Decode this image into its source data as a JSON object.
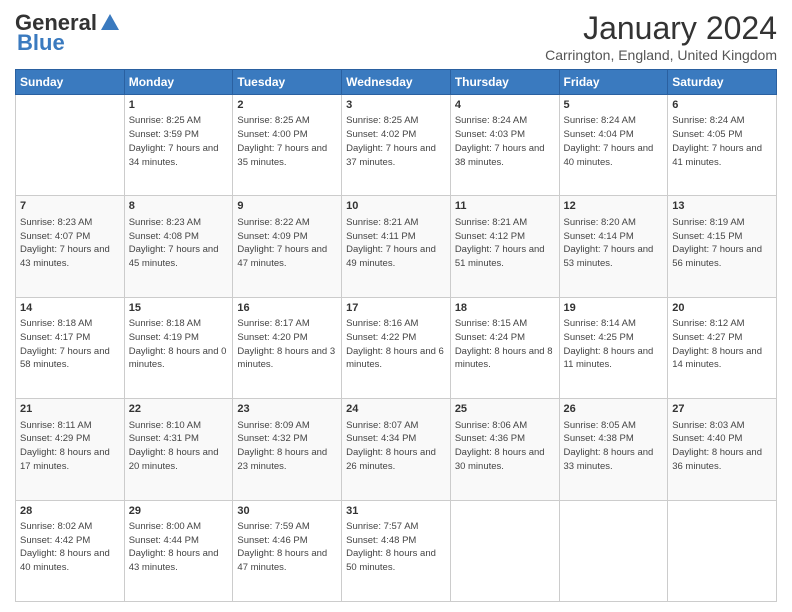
{
  "logo": {
    "general": "General",
    "blue": "Blue"
  },
  "header": {
    "month": "January 2024",
    "location": "Carrington, England, United Kingdom"
  },
  "days": [
    "Sunday",
    "Monday",
    "Tuesday",
    "Wednesday",
    "Thursday",
    "Friday",
    "Saturday"
  ],
  "weeks": [
    [
      {
        "day": "",
        "sunrise": "",
        "sunset": "",
        "daylight": ""
      },
      {
        "day": "1",
        "sunrise": "Sunrise: 8:25 AM",
        "sunset": "Sunset: 3:59 PM",
        "daylight": "Daylight: 7 hours and 34 minutes."
      },
      {
        "day": "2",
        "sunrise": "Sunrise: 8:25 AM",
        "sunset": "Sunset: 4:00 PM",
        "daylight": "Daylight: 7 hours and 35 minutes."
      },
      {
        "day": "3",
        "sunrise": "Sunrise: 8:25 AM",
        "sunset": "Sunset: 4:02 PM",
        "daylight": "Daylight: 7 hours and 37 minutes."
      },
      {
        "day": "4",
        "sunrise": "Sunrise: 8:24 AM",
        "sunset": "Sunset: 4:03 PM",
        "daylight": "Daylight: 7 hours and 38 minutes."
      },
      {
        "day": "5",
        "sunrise": "Sunrise: 8:24 AM",
        "sunset": "Sunset: 4:04 PM",
        "daylight": "Daylight: 7 hours and 40 minutes."
      },
      {
        "day": "6",
        "sunrise": "Sunrise: 8:24 AM",
        "sunset": "Sunset: 4:05 PM",
        "daylight": "Daylight: 7 hours and 41 minutes."
      }
    ],
    [
      {
        "day": "7",
        "sunrise": "Sunrise: 8:23 AM",
        "sunset": "Sunset: 4:07 PM",
        "daylight": "Daylight: 7 hours and 43 minutes."
      },
      {
        "day": "8",
        "sunrise": "Sunrise: 8:23 AM",
        "sunset": "Sunset: 4:08 PM",
        "daylight": "Daylight: 7 hours and 45 minutes."
      },
      {
        "day": "9",
        "sunrise": "Sunrise: 8:22 AM",
        "sunset": "Sunset: 4:09 PM",
        "daylight": "Daylight: 7 hours and 47 minutes."
      },
      {
        "day": "10",
        "sunrise": "Sunrise: 8:21 AM",
        "sunset": "Sunset: 4:11 PM",
        "daylight": "Daylight: 7 hours and 49 minutes."
      },
      {
        "day": "11",
        "sunrise": "Sunrise: 8:21 AM",
        "sunset": "Sunset: 4:12 PM",
        "daylight": "Daylight: 7 hours and 51 minutes."
      },
      {
        "day": "12",
        "sunrise": "Sunrise: 8:20 AM",
        "sunset": "Sunset: 4:14 PM",
        "daylight": "Daylight: 7 hours and 53 minutes."
      },
      {
        "day": "13",
        "sunrise": "Sunrise: 8:19 AM",
        "sunset": "Sunset: 4:15 PM",
        "daylight": "Daylight: 7 hours and 56 minutes."
      }
    ],
    [
      {
        "day": "14",
        "sunrise": "Sunrise: 8:18 AM",
        "sunset": "Sunset: 4:17 PM",
        "daylight": "Daylight: 7 hours and 58 minutes."
      },
      {
        "day": "15",
        "sunrise": "Sunrise: 8:18 AM",
        "sunset": "Sunset: 4:19 PM",
        "daylight": "Daylight: 8 hours and 0 minutes."
      },
      {
        "day": "16",
        "sunrise": "Sunrise: 8:17 AM",
        "sunset": "Sunset: 4:20 PM",
        "daylight": "Daylight: 8 hours and 3 minutes."
      },
      {
        "day": "17",
        "sunrise": "Sunrise: 8:16 AM",
        "sunset": "Sunset: 4:22 PM",
        "daylight": "Daylight: 8 hours and 6 minutes."
      },
      {
        "day": "18",
        "sunrise": "Sunrise: 8:15 AM",
        "sunset": "Sunset: 4:24 PM",
        "daylight": "Daylight: 8 hours and 8 minutes."
      },
      {
        "day": "19",
        "sunrise": "Sunrise: 8:14 AM",
        "sunset": "Sunset: 4:25 PM",
        "daylight": "Daylight: 8 hours and 11 minutes."
      },
      {
        "day": "20",
        "sunrise": "Sunrise: 8:12 AM",
        "sunset": "Sunset: 4:27 PM",
        "daylight": "Daylight: 8 hours and 14 minutes."
      }
    ],
    [
      {
        "day": "21",
        "sunrise": "Sunrise: 8:11 AM",
        "sunset": "Sunset: 4:29 PM",
        "daylight": "Daylight: 8 hours and 17 minutes."
      },
      {
        "day": "22",
        "sunrise": "Sunrise: 8:10 AM",
        "sunset": "Sunset: 4:31 PM",
        "daylight": "Daylight: 8 hours and 20 minutes."
      },
      {
        "day": "23",
        "sunrise": "Sunrise: 8:09 AM",
        "sunset": "Sunset: 4:32 PM",
        "daylight": "Daylight: 8 hours and 23 minutes."
      },
      {
        "day": "24",
        "sunrise": "Sunrise: 8:07 AM",
        "sunset": "Sunset: 4:34 PM",
        "daylight": "Daylight: 8 hours and 26 minutes."
      },
      {
        "day": "25",
        "sunrise": "Sunrise: 8:06 AM",
        "sunset": "Sunset: 4:36 PM",
        "daylight": "Daylight: 8 hours and 30 minutes."
      },
      {
        "day": "26",
        "sunrise": "Sunrise: 8:05 AM",
        "sunset": "Sunset: 4:38 PM",
        "daylight": "Daylight: 8 hours and 33 minutes."
      },
      {
        "day": "27",
        "sunrise": "Sunrise: 8:03 AM",
        "sunset": "Sunset: 4:40 PM",
        "daylight": "Daylight: 8 hours and 36 minutes."
      }
    ],
    [
      {
        "day": "28",
        "sunrise": "Sunrise: 8:02 AM",
        "sunset": "Sunset: 4:42 PM",
        "daylight": "Daylight: 8 hours and 40 minutes."
      },
      {
        "day": "29",
        "sunrise": "Sunrise: 8:00 AM",
        "sunset": "Sunset: 4:44 PM",
        "daylight": "Daylight: 8 hours and 43 minutes."
      },
      {
        "day": "30",
        "sunrise": "Sunrise: 7:59 AM",
        "sunset": "Sunset: 4:46 PM",
        "daylight": "Daylight: 8 hours and 47 minutes."
      },
      {
        "day": "31",
        "sunrise": "Sunrise: 7:57 AM",
        "sunset": "Sunset: 4:48 PM",
        "daylight": "Daylight: 8 hours and 50 minutes."
      },
      {
        "day": "",
        "sunrise": "",
        "sunset": "",
        "daylight": ""
      },
      {
        "day": "",
        "sunrise": "",
        "sunset": "",
        "daylight": ""
      },
      {
        "day": "",
        "sunrise": "",
        "sunset": "",
        "daylight": ""
      }
    ]
  ]
}
